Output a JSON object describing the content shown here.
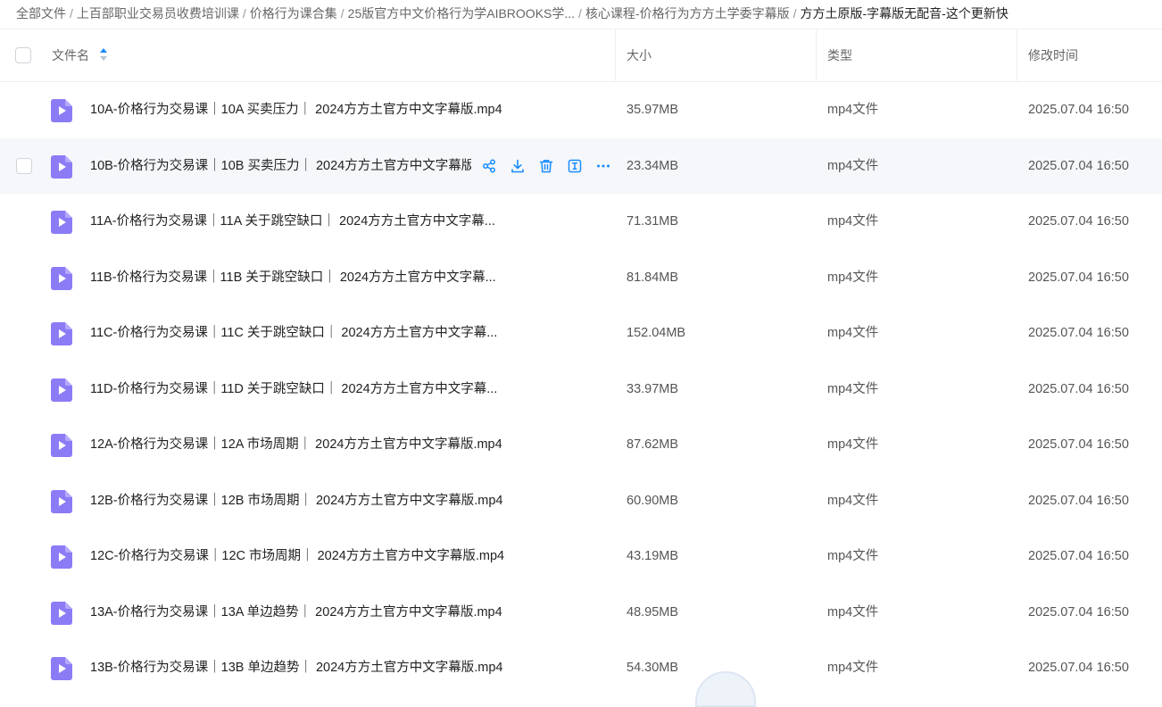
{
  "breadcrumb": {
    "items": [
      "全部文件",
      "上百部职业交易员收费培训课",
      "价格行为课合集",
      "25版官方中文价格行为学AIBROOKS学...",
      "核心课程-价格行为方方土学委字幕版"
    ],
    "current": "方方土原版-字幕版无配音-这个更新快",
    "separator": "/"
  },
  "table": {
    "columns": {
      "name": "文件名",
      "size": "大小",
      "type": "类型",
      "modified": "修改时间"
    },
    "rows": [
      {
        "name": "10A-价格行为交易课｜10A 买卖压力｜ 2024方方土官方中文字幕版.mp4",
        "size": "35.97MB",
        "type": "mp4文件",
        "modified": "2025.07.04 16:50"
      },
      {
        "name": "10B-价格行为交易课｜10B 买卖压力｜ 2024方方土官方中文字幕版.mp4",
        "size": "23.34MB",
        "type": "mp4文件",
        "modified": "2025.07.04 16:50"
      },
      {
        "name": "11A-价格行为交易课｜11A 关于跳空缺口｜ 2024方方土官方中文字幕...",
        "size": "71.31MB",
        "type": "mp4文件",
        "modified": "2025.07.04 16:50"
      },
      {
        "name": "11B-价格行为交易课｜11B 关于跳空缺口｜ 2024方方土官方中文字幕...",
        "size": "81.84MB",
        "type": "mp4文件",
        "modified": "2025.07.04 16:50"
      },
      {
        "name": "11C-价格行为交易课｜11C 关于跳空缺口｜ 2024方方土官方中文字幕...",
        "size": "152.04MB",
        "type": "mp4文件",
        "modified": "2025.07.04 16:50"
      },
      {
        "name": "11D-价格行为交易课｜11D 关于跳空缺口｜ 2024方方土官方中文字幕...",
        "size": "33.97MB",
        "type": "mp4文件",
        "modified": "2025.07.04 16:50"
      },
      {
        "name": "12A-价格行为交易课｜12A 市场周期｜ 2024方方土官方中文字幕版.mp4",
        "size": "87.62MB",
        "type": "mp4文件",
        "modified": "2025.07.04 16:50"
      },
      {
        "name": "12B-价格行为交易课｜12B 市场周期｜ 2024方方土官方中文字幕版.mp4",
        "size": "60.90MB",
        "type": "mp4文件",
        "modified": "2025.07.04 16:50"
      },
      {
        "name": "12C-价格行为交易课｜12C 市场周期｜ 2024方方土官方中文字幕版.mp4",
        "size": "43.19MB",
        "type": "mp4文件",
        "modified": "2025.07.04 16:50"
      },
      {
        "name": "13A-价格行为交易课｜13A 单边趋势｜ 2024方方土官方中文字幕版.mp4",
        "size": "48.95MB",
        "type": "mp4文件",
        "modified": "2025.07.04 16:50"
      },
      {
        "name": "13B-价格行为交易课｜13B 单边趋势｜ 2024方方土官方中文字幕版.mp4",
        "size": "54.30MB",
        "type": "mp4文件",
        "modified": "2025.07.04 16:50"
      }
    ],
    "hovered_row": 1
  },
  "icons": {
    "file": "video-file-icon",
    "row_actions": [
      "share-icon",
      "download-icon",
      "delete-icon",
      "rename-icon",
      "more-icon"
    ]
  },
  "colors": {
    "accent": "#1a8cff",
    "file_icon": "#8b7cf6",
    "hover_row": "#f5f7fa"
  }
}
